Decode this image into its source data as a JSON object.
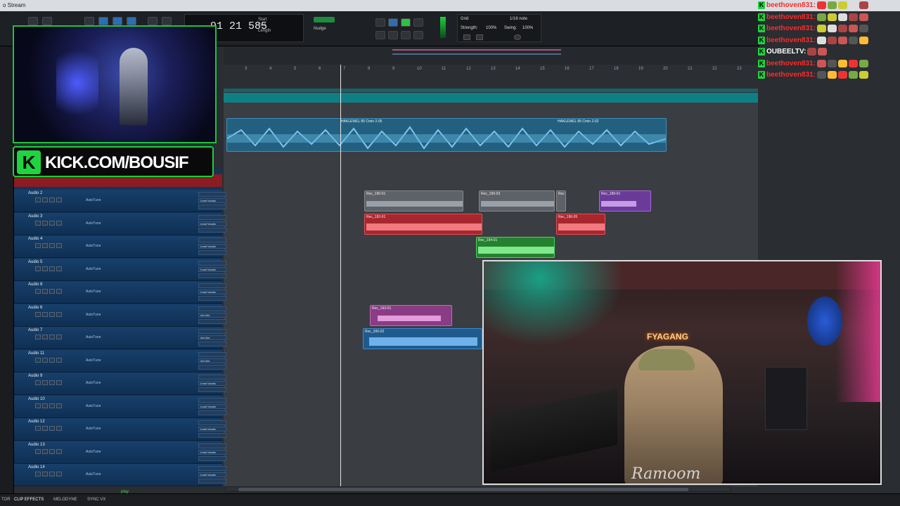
{
  "window": {
    "title": "o Stream"
  },
  "toolbar": {
    "counter_main": "91 21 585",
    "counter_labels": [
      "Start",
      "End",
      "Length"
    ],
    "grid_label": "Grid",
    "grid_value": "1/16 note",
    "strength_label": "Strength:",
    "strength_value": "100%",
    "swing_label": "Swing:",
    "swing_value": "100%",
    "nudge_label": "Nudge"
  },
  "ruler": {
    "bars": [
      "3",
      "4",
      "5",
      "6",
      "7",
      "8",
      "9",
      "10",
      "11",
      "12",
      "13",
      "14",
      "15",
      "16",
      "17",
      "18",
      "19",
      "20",
      "21",
      "22",
      "23",
      "24"
    ]
  },
  "kick": {
    "url": "KICK.COM/BOUSIF"
  },
  "chat": {
    "messages": [
      {
        "user": "beethoven831:",
        "color": "#ff2a2a"
      },
      {
        "user": "beethoven831:",
        "color": "#ff2a2a"
      },
      {
        "user": "beethoven831:",
        "color": "#ff2a2a"
      },
      {
        "user": "beethoven831:",
        "color": "#ff2a2a"
      },
      {
        "user": "OUBEELTV:",
        "color": "#ffffff"
      },
      {
        "user": "beethoven831:",
        "color": "#ff2a2a"
      },
      {
        "user": "beethoven831:",
        "color": "#ff2a2a"
      }
    ]
  },
  "tracks": [
    {
      "name": "Audio 2",
      "plugin": "AutoTune",
      "insert": "Lead Vocals"
    },
    {
      "name": "Audio 3",
      "plugin": "AutoTune",
      "insert": "Lead Vocals"
    },
    {
      "name": "Audio 4",
      "plugin": "AutoTune",
      "insert": "Lead Vocals"
    },
    {
      "name": "Audio 5",
      "plugin": "AutoTune",
      "insert": "Lead Vocals"
    },
    {
      "name": "Audio 8",
      "plugin": "AutoTune",
      "insert": "Lead Vocals"
    },
    {
      "name": "Audio 6",
      "plugin": "AutoTune",
      "insert": "Ad Libs"
    },
    {
      "name": "Audio 7",
      "plugin": "AutoTune",
      "insert": "Ad Libs"
    },
    {
      "name": "Audio 11",
      "plugin": "AutoTune",
      "insert": "Ad Libs"
    },
    {
      "name": "Audio 9",
      "plugin": "AutoTune",
      "insert": "Lead Vocals"
    },
    {
      "name": "Audio 10",
      "plugin": "AutoTune",
      "insert": "Lead Vocals"
    },
    {
      "name": "Audio 12",
      "plugin": "AutoTune",
      "insert": "Lead Vocals"
    },
    {
      "name": "Audio 13",
      "plugin": "AutoTune",
      "insert": "Lead Vocals"
    },
    {
      "name": "Audio 14",
      "plugin": "AutoTune",
      "insert": "Lead Vocals"
    }
  ],
  "clips": {
    "beat1": "HAKLEWEL 85 Cmin 2-05",
    "beat2": "HAKLEWEL 85 Cmin 2-02",
    "c1": "Rec_190-01",
    "c2": "Rec_190-03",
    "c3": "Rec",
    "c4": "Rec_189-01",
    "c5": "Rec_192-01",
    "c6": "Rec_196-05",
    "c7": "Rec_194-01",
    "c8": "Rec_193-01",
    "c9": "Rec_200-02"
  },
  "cam2": {
    "sign": "FYAGANG",
    "signature": "Ramoom"
  },
  "bottom": {
    "tab1": "CLIP EFFECTS",
    "tab2": "MELODYNE",
    "tab3": "SYNC VX",
    "tab0": "TOR",
    "play": "play"
  },
  "colors": {
    "kick_green": "#1ed43f",
    "clip_blue": "#2a86b8",
    "clip_red": "#c9343a",
    "clip_green": "#35b04a",
    "clip_purple": "#8f4ac0",
    "clip_gray": "#6c7077",
    "track_blue": "#17406b"
  }
}
